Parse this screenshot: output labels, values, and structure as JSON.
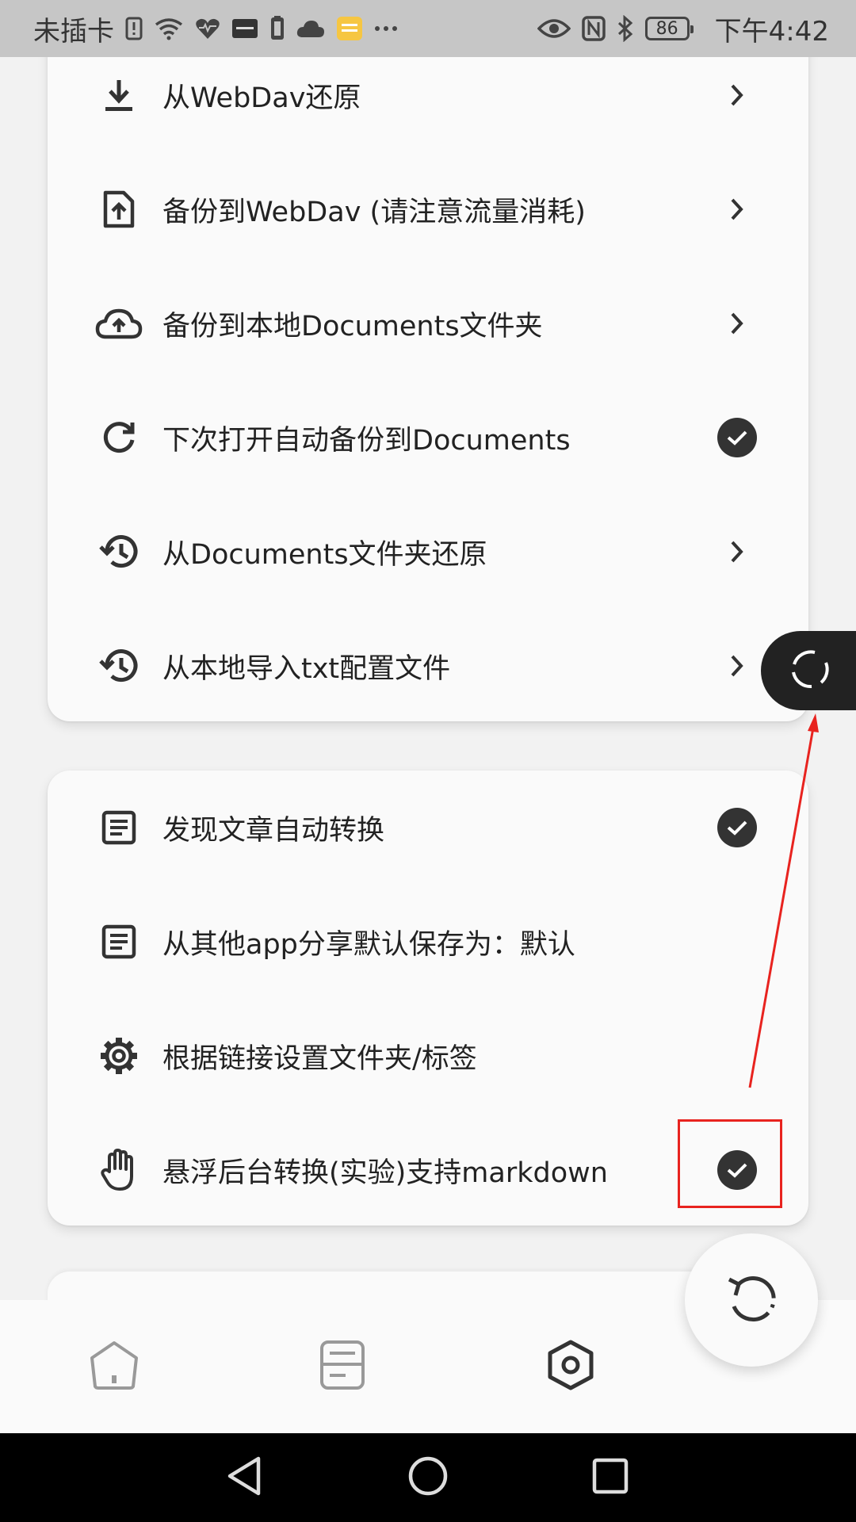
{
  "status_bar": {
    "carrier": "未插卡",
    "battery": "86",
    "time": "下午4:42",
    "icons": [
      "sim-alert-icon",
      "wifi-icon",
      "health-icon",
      "app-icon",
      "phone-icon",
      "cloud-icon",
      "notes-icon",
      "more-icon",
      "eye-icon",
      "nfc-icon",
      "bluetooth-icon",
      "battery-icon"
    ]
  },
  "backup_section": {
    "items": [
      {
        "label": "从WebDav还原",
        "icon": "download-icon",
        "trailing": "chevron-right-icon"
      },
      {
        "label": "备份到WebDav (请注意流量消耗)",
        "icon": "file-upload-icon",
        "trailing": "chevron-right-icon"
      },
      {
        "label": "备份到本地Documents文件夹",
        "icon": "cloud-upload-icon",
        "trailing": "chevron-right-icon"
      },
      {
        "label": "下次打开自动备份到Documents",
        "icon": "refresh-icon",
        "trailing": "check-icon"
      },
      {
        "label": "从Documents文件夹还原",
        "icon": "history-icon",
        "trailing": "chevron-right-icon"
      },
      {
        "label": "从本地导入txt配置文件",
        "icon": "history-icon",
        "trailing": "chevron-right-icon"
      }
    ]
  },
  "conversion_section": {
    "items": [
      {
        "label": "发现文章自动转换",
        "icon": "article-icon",
        "trailing": "check-icon"
      },
      {
        "label": "从其他app分享默认保存为：默认",
        "icon": "article-icon",
        "trailing": ""
      },
      {
        "label": "根据链接设置文件夹/标签",
        "icon": "gear-icon",
        "trailing": ""
      },
      {
        "label": "悬浮后台转换(实验)支持markdown",
        "icon": "hand-icon",
        "trailing": "check-icon"
      }
    ]
  },
  "floating_bubble": {
    "icon": "float-ring-icon"
  },
  "fab": {
    "icon": "undo-icon"
  },
  "bottom_nav": {
    "items": [
      {
        "icon": "home-icon",
        "active": false
      },
      {
        "icon": "notes-list-icon",
        "active": false
      },
      {
        "icon": "settings-hex-icon",
        "active": true
      }
    ]
  },
  "system_nav": {
    "icons": [
      "back-icon",
      "home-circle-icon",
      "recents-icon"
    ]
  },
  "colors": {
    "accent": "#333333",
    "annotation": "#e8231f",
    "background": "#f2f2f2",
    "card": "#fafafa"
  }
}
